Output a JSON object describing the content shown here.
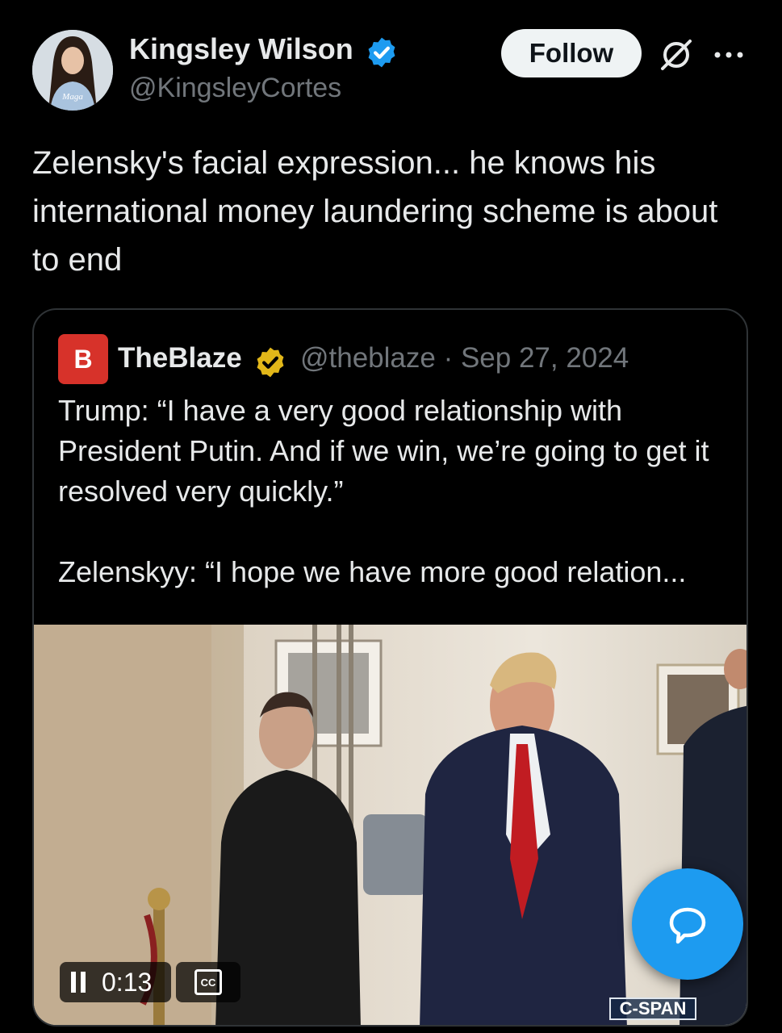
{
  "author": {
    "name": "Kingsley Wilson",
    "handle": "@KingsleyCortes",
    "avatar_text": "Maga Republican"
  },
  "actions": {
    "follow_label": "Follow"
  },
  "tweet": {
    "text": "Zelensky's facial expression... he knows his international money laundering scheme is about to end"
  },
  "quote": {
    "name": "TheBlaze",
    "logo_letter": "B",
    "meta": "@theblaze · Sep 27, 2024",
    "paragraph1": "Trump: “I have a very good relationship with President Putin. And if we win, we’re going to get it resolved very quickly.”",
    "paragraph2": "Zelenskyy: “I hope we have more good relation..."
  },
  "video": {
    "time": "0:13",
    "cc_label": "CC",
    "watermark": "C-SPAN"
  },
  "colors": {
    "accent": "#1d9bf0",
    "badge_gold": "#e2b719",
    "blaze_red": "#d7322a"
  },
  "icons": [
    "verified-badge-icon",
    "grok-icon",
    "more-icon",
    "gold-badge-icon",
    "pause-icon",
    "closed-captions-icon",
    "compose-reply-icon"
  ]
}
